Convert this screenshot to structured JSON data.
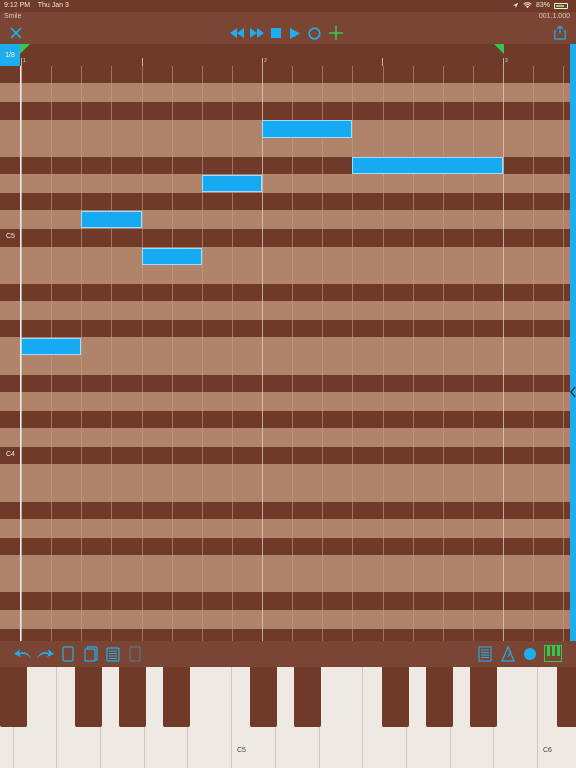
{
  "status": {
    "time": "9:12 PM",
    "date": "Thu Jan 3",
    "battery": "83%",
    "battery_level": 0.83
  },
  "app": {
    "title": "Smile",
    "position": "001.1.000"
  },
  "toolbar": {
    "icons": [
      "close-icon",
      "rewind-icon",
      "fast-forward-icon",
      "stop-icon",
      "play-icon",
      "loop-icon",
      "add-marker-icon",
      "share-icon"
    ]
  },
  "ruler": {
    "quantize": "1/8",
    "bars": [
      "1",
      "2",
      "3"
    ],
    "markers": [
      "loop-start-marker",
      "loop-end-marker"
    ]
  },
  "pitch_labels": {
    "c5": "C5",
    "c4": "C4"
  },
  "notes": [
    {
      "pitch": "C4",
      "start": 0.0,
      "length": 0.25
    },
    {
      "pitch": "G4",
      "start": 0.25,
      "length": 0.25
    },
    {
      "pitch": "F4",
      "start": 0.5,
      "length": 0.25
    },
    {
      "pitch": "A4",
      "start": 0.75,
      "length": 0.25
    },
    {
      "pitch": "C5",
      "start": 1.0,
      "length": 0.375
    },
    {
      "pitch": "A#4",
      "start": 1.375,
      "length": 0.625
    }
  ],
  "bottom_toolbar": {
    "left_icons": [
      "undo-icon",
      "redo-icon",
      "copy-icon",
      "duplicate-icon",
      "paste-icon",
      "delete-icon"
    ],
    "right_icons": [
      "list-view-icon",
      "metronome-icon",
      "record-icon",
      "keyboard-view-icon"
    ]
  },
  "keyboard": {
    "labels": [
      "C5",
      "C6"
    ]
  },
  "colors": {
    "brown_dark": "#6f3a28",
    "brown_light": "#b0846a",
    "accent": "#1eaef0",
    "green": "#31c94f"
  }
}
